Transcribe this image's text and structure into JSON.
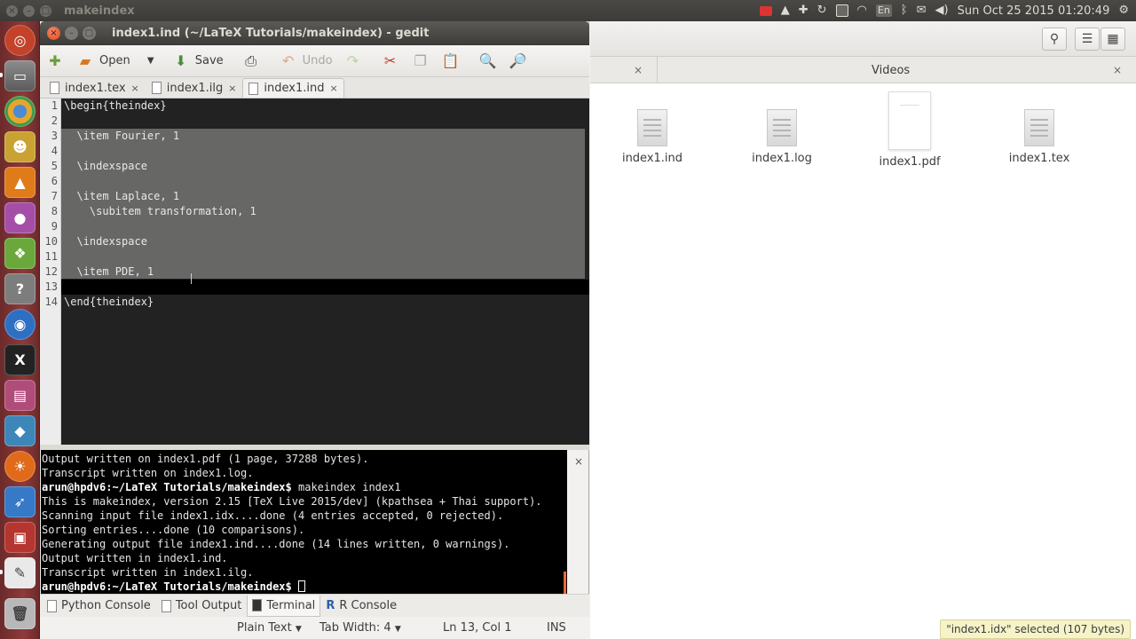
{
  "top_panel": {
    "app_title": "makeindex",
    "clock": "Sun Oct 25 2015 01:20:49",
    "tray_icons": [
      "recorder-icon",
      "dropbox-icon",
      "puzzle-icon",
      "update-icon",
      "clipboard-icon",
      "wifi-icon",
      "keyboard-layout-icon",
      "bluetooth-icon",
      "mail-icon",
      "volume-icon",
      "gear-icon"
    ],
    "keyboard_label": "En"
  },
  "launcher": {
    "items": [
      "ubuntu-dash-icon",
      "files-icon",
      "chromium-icon",
      "gimp-icon",
      "vlc-icon",
      "screen-recorder-icon",
      "apps-icon",
      "help-icon",
      "blue-app-icon",
      "terminal-x-icon",
      "calendar-app-icon",
      "cube-app-icon",
      "firefox-icon",
      "fish-app-icon",
      "presentation-icon",
      "text-editor-icon",
      "trash-icon"
    ]
  },
  "gedit": {
    "title": "index1.ind (~/LaTeX Tutorials/makeindex) - gedit",
    "toolbar": {
      "new_label": "",
      "open_label": "Open",
      "save_label": "Save",
      "undo_label": "Undo"
    },
    "tabs": [
      {
        "label": "index1.tex"
      },
      {
        "label": "index1.ilg"
      },
      {
        "label": "index1.ind"
      }
    ],
    "editor_lines": [
      {
        "num": "1",
        "text": "\\begin{theindex}"
      },
      {
        "num": "2",
        "text": ""
      },
      {
        "num": "3",
        "text": "  \\item Fourier, 1"
      },
      {
        "num": "4",
        "text": ""
      },
      {
        "num": "5",
        "text": "  \\indexspace"
      },
      {
        "num": "6",
        "text": ""
      },
      {
        "num": "7",
        "text": "  \\item Laplace, 1"
      },
      {
        "num": "8",
        "text": "    \\subitem transformation, 1"
      },
      {
        "num": "9",
        "text": ""
      },
      {
        "num": "10",
        "text": "  \\indexspace"
      },
      {
        "num": "11",
        "text": ""
      },
      {
        "num": "12",
        "text": "  \\item PDE, 1"
      },
      {
        "num": "13",
        "text": ""
      },
      {
        "num": "14",
        "text": "\\end{theindex}"
      }
    ],
    "terminal_lines": [
      {
        "prompt": "",
        "text": "Output written on index1.pdf (1 page, 37288 bytes)."
      },
      {
        "prompt": "",
        "text": "Transcript written on index1.log."
      },
      {
        "prompt": "arun@hpdv6:~/LaTeX Tutorials/makeindex$",
        "text": " makeindex index1"
      },
      {
        "prompt": "",
        "text": "This is makeindex, version 2.15 [TeX Live 2015/dev] (kpathsea + Thai support)."
      },
      {
        "prompt": "",
        "text": "Scanning input file index1.idx....done (4 entries accepted, 0 rejected)."
      },
      {
        "prompt": "",
        "text": "Sorting entries....done (10 comparisons)."
      },
      {
        "prompt": "",
        "text": "Generating output file index1.ind....done (14 lines written, 0 warnings)."
      },
      {
        "prompt": "",
        "text": "Output written in index1.ind."
      },
      {
        "prompt": "",
        "text": "Transcript written in index1.ilg."
      },
      {
        "prompt": "arun@hpdv6:~/LaTeX Tutorials/makeindex$",
        "text": " "
      }
    ],
    "bottom_tabs": [
      {
        "label": "Python Console"
      },
      {
        "label": "Tool Output"
      },
      {
        "label": "Terminal"
      },
      {
        "label": "R Console"
      }
    ],
    "statusbar": {
      "language": "Plain Text",
      "tab_width": "Tab Width: 4",
      "position": "Ln 13, Col 1",
      "mode": "INS"
    }
  },
  "nautilus": {
    "tab_title": "Videos",
    "files": [
      {
        "name": "index1.ind"
      },
      {
        "name": "index1.log"
      },
      {
        "name": "index1.pdf"
      },
      {
        "name": "index1.tex"
      }
    ],
    "status": "\"index1.idx\" selected  (107 bytes)"
  }
}
